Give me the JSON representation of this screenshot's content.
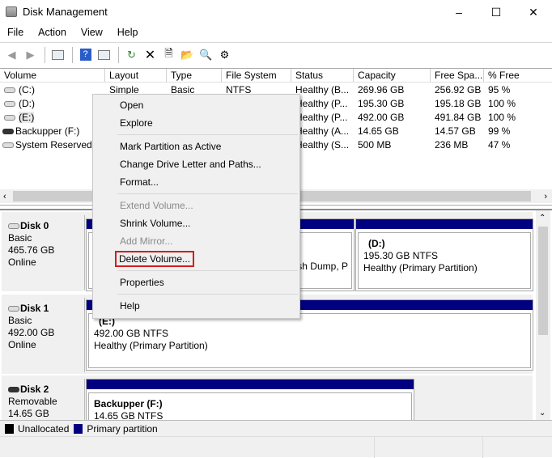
{
  "window": {
    "title": "Disk Management",
    "minimize_label": "–",
    "maximize_label": "☐",
    "close_label": "✕"
  },
  "menubar": [
    "File",
    "Action",
    "View",
    "Help"
  ],
  "toolbar": {
    "icons": [
      "back-icon",
      "forward-icon",
      "show-hide-console-tree-icon",
      "help-icon",
      "show-hide-action-pane-icon",
      "refresh-icon",
      "delete-icon",
      "properties-icon",
      "open-icon",
      "explore-icon",
      "settings-icon"
    ]
  },
  "volume_list": {
    "columns": [
      "Volume",
      "Layout",
      "Type",
      "File System",
      "Status",
      "Capacity",
      "Free Spa...",
      "% Free"
    ],
    "rows": [
      {
        "volume": "(C:)",
        "layout": "Simple",
        "type": "Basic",
        "fs": "NTFS",
        "status": "Healthy (B...",
        "capacity": "269.96 GB",
        "free": "256.92 GB",
        "pct": "95 %"
      },
      {
        "volume": "(D:)",
        "layout": "",
        "type": "",
        "fs": "",
        "status": "Healthy (P...",
        "capacity": "195.30 GB",
        "free": "195.18 GB",
        "pct": "100 %"
      },
      {
        "volume": "(E:)",
        "layout": "",
        "type": "",
        "fs": "",
        "status": "Healthy (P...",
        "capacity": "492.00 GB",
        "free": "491.84 GB",
        "pct": "100 %"
      },
      {
        "volume": "Backupper (F:)",
        "layout": "",
        "type": "",
        "fs": "",
        "status": "Healthy (A...",
        "capacity": "14.65 GB",
        "free": "14.57 GB",
        "pct": "99 %"
      },
      {
        "volume": "System Reserved",
        "layout": "",
        "type": "",
        "fs": "",
        "status": "Healthy (S...",
        "capacity": "500 MB",
        "free": "236 MB",
        "pct": "47 %"
      }
    ]
  },
  "disks": [
    {
      "name": "Disk 0",
      "type": "Basic",
      "size": "465.76 GB",
      "status": "Online",
      "partitions": [
        {
          "label": "",
          "detail": "",
          "status": "ash Dump, P"
        },
        {
          "label": "(D:)",
          "detail": "195.30 GB NTFS",
          "status": "Healthy (Primary Partition)"
        }
      ]
    },
    {
      "name": "Disk 1",
      "type": "Basic",
      "size": "492.00 GB",
      "status": "Online",
      "partitions": [
        {
          "label": "(E:)",
          "detail": "492.00 GB NTFS",
          "status": "Healthy (Primary Partition)"
        }
      ]
    },
    {
      "name": "Disk 2",
      "type": "Removable",
      "size": "14.65 GB",
      "status": "",
      "partitions": [
        {
          "label": "Backupper  (F:)",
          "detail": "14.65 GB NTFS",
          "status": ""
        }
      ]
    }
  ],
  "legend": [
    {
      "label": "Unallocated",
      "color": "#000000"
    },
    {
      "label": "Primary partition",
      "color": "#000080"
    }
  ],
  "context_menu": {
    "items": [
      {
        "label": "Open",
        "enabled": true
      },
      {
        "label": "Explore",
        "enabled": true
      },
      {
        "label": "Mark Partition as Active",
        "enabled": true
      },
      {
        "label": "Change Drive Letter and Paths...",
        "enabled": true
      },
      {
        "label": "Format...",
        "enabled": true
      },
      {
        "label": "Extend Volume...",
        "enabled": false
      },
      {
        "label": "Shrink Volume...",
        "enabled": true
      },
      {
        "label": "Add Mirror...",
        "enabled": false
      },
      {
        "label": "Delete Volume...",
        "enabled": true,
        "highlighted": true
      },
      {
        "label": "Properties",
        "enabled": true
      },
      {
        "label": "Help",
        "enabled": true
      }
    ]
  }
}
